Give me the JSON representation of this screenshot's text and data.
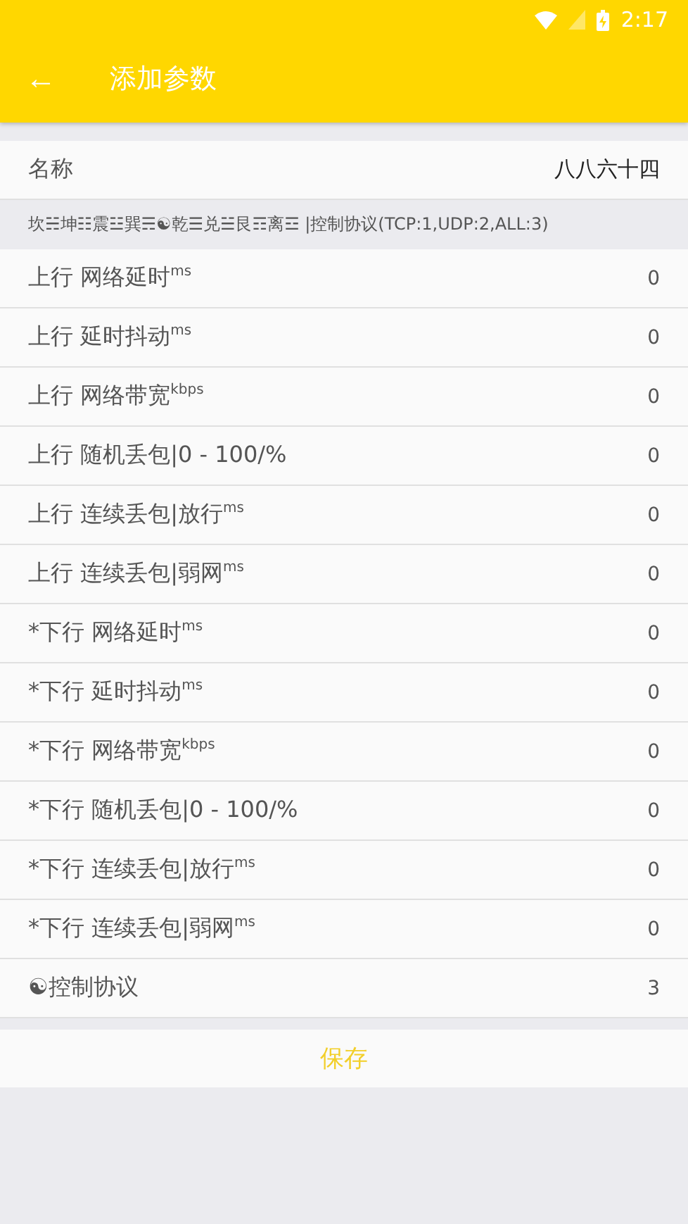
{
  "status_bar": {
    "time": "2:17"
  },
  "toolbar": {
    "back": "←",
    "title": "添加参数"
  },
  "name_row": {
    "label": "名称",
    "value": "八八六十四"
  },
  "hint": "坎☵坤☷震☳巽☴☯乾☰兑☱艮☶离☲ |控制协议(TCP:1,UDP:2,ALL:3)",
  "params": [
    {
      "label": "上行 网络延时$^{ms}$",
      "value": "0"
    },
    {
      "label": "上行 延时抖动$^{ms}$",
      "value": "0"
    },
    {
      "label": "上行 网络带宽$^{kbps}$",
      "value": "0"
    },
    {
      "label": "上行 随机丢包|0 - 100/%",
      "value": "0"
    },
    {
      "label": "上行 连续丢包|放行$^{ms}$",
      "value": "0"
    },
    {
      "label": "上行 连续丢包|弱网$^{ms}$",
      "value": "0"
    },
    {
      "label": "*下行 网络延时$^{ms}$",
      "value": "0"
    },
    {
      "label": "*下行 延时抖动$^{ms}$",
      "value": "0"
    },
    {
      "label": "*下行 网络带宽$^{kbps}$",
      "value": "0"
    },
    {
      "label": "*下行 随机丢包|0 - 100/%",
      "value": "0"
    },
    {
      "label": "*下行 连续丢包|放行$^{ms}$",
      "value": "0"
    },
    {
      "label": "*下行 连续丢包|弱网$^{ms}$",
      "value": "0"
    },
    {
      "label": "☯控制协议",
      "value": "3"
    }
  ],
  "save_button": "保存"
}
